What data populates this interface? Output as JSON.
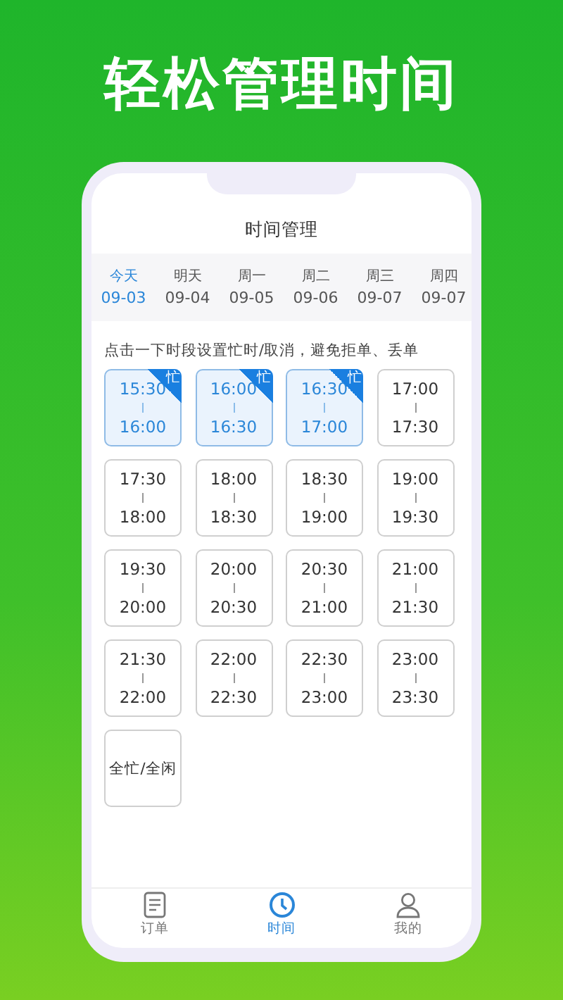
{
  "headline": "轻松管理时间",
  "screen_title": "时间管理",
  "day_tabs": [
    {
      "day": "今天",
      "date": "09-03",
      "selected": true
    },
    {
      "day": "明天",
      "date": "09-04",
      "selected": false
    },
    {
      "day": "周一",
      "date": "09-05",
      "selected": false
    },
    {
      "day": "周二",
      "date": "09-06",
      "selected": false
    },
    {
      "day": "周三",
      "date": "09-07",
      "selected": false
    },
    {
      "day": "周四",
      "date": "09-07",
      "selected": false
    }
  ],
  "hint": "点击一下时段设置忙时/取消，避免拒单、丢单",
  "slots": [
    {
      "start": "15:30",
      "end": "16:00",
      "busy": true,
      "badge": "忙"
    },
    {
      "start": "16:00",
      "end": "16:30",
      "busy": true,
      "badge": "忙"
    },
    {
      "start": "16:30",
      "end": "17:00",
      "busy": true,
      "badge": "忙"
    },
    {
      "start": "17:00",
      "end": "17:30",
      "busy": false
    },
    {
      "start": "17:30",
      "end": "18:00",
      "busy": false
    },
    {
      "start": "18:00",
      "end": "18:30",
      "busy": false
    },
    {
      "start": "18:30",
      "end": "19:00",
      "busy": false
    },
    {
      "start": "19:00",
      "end": "19:30",
      "busy": false
    },
    {
      "start": "19:30",
      "end": "20:00",
      "busy": false
    },
    {
      "start": "20:00",
      "end": "20:30",
      "busy": false
    },
    {
      "start": "20:30",
      "end": "21:00",
      "busy": false
    },
    {
      "start": "21:00",
      "end": "21:30",
      "busy": false
    },
    {
      "start": "21:30",
      "end": "22:00",
      "busy": false
    },
    {
      "start": "22:00",
      "end": "22:30",
      "busy": false
    },
    {
      "start": "22:30",
      "end": "23:00",
      "busy": false
    },
    {
      "start": "23:00",
      "end": "23:30",
      "busy": false
    }
  ],
  "all_toggle": "全忙/全闲",
  "bottom_nav": [
    {
      "label": "订单",
      "kind": "orders",
      "selected": false
    },
    {
      "label": "时间",
      "kind": "time",
      "selected": true
    },
    {
      "label": "我的",
      "kind": "profile",
      "selected": false
    }
  ]
}
